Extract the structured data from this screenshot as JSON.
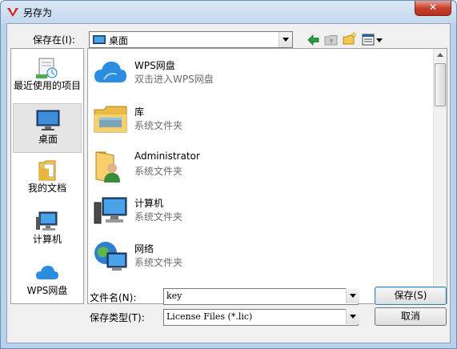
{
  "window": {
    "title": "另存为",
    "close_label": "✕"
  },
  "location": {
    "label": "保存在(I):",
    "value": "桌面"
  },
  "places": [
    {
      "label": "最近使用的项目",
      "icon": "recent-items-icon"
    },
    {
      "label": "桌面",
      "icon": "desktop-icon"
    },
    {
      "label": "我的文档",
      "icon": "documents-icon"
    },
    {
      "label": "计算机",
      "icon": "computer-icon"
    },
    {
      "label": "WPS网盘",
      "icon": "cloud-icon"
    }
  ],
  "items": [
    {
      "name": "WPS网盘",
      "sub": "双击进入WPS网盘",
      "icon": "cloud-icon"
    },
    {
      "name": "库",
      "sub": "系统文件夹",
      "icon": "library-icon"
    },
    {
      "name": "Administrator",
      "sub": "系统文件夹",
      "icon": "user-folder-icon"
    },
    {
      "name": "计算机",
      "sub": "系统文件夹",
      "icon": "computer-icon"
    },
    {
      "name": "网络",
      "sub": "系统文件夹",
      "icon": "network-icon"
    }
  ],
  "filename": {
    "label": "文件名(N):",
    "value": "key"
  },
  "filetype": {
    "label": "保存类型(T):",
    "value": "License Files (*.lic)"
  },
  "buttons": {
    "save": "保存(S)",
    "cancel": "取消"
  },
  "colors": {
    "accent": "#3c7fb1",
    "cloud": "#2a8de0"
  }
}
